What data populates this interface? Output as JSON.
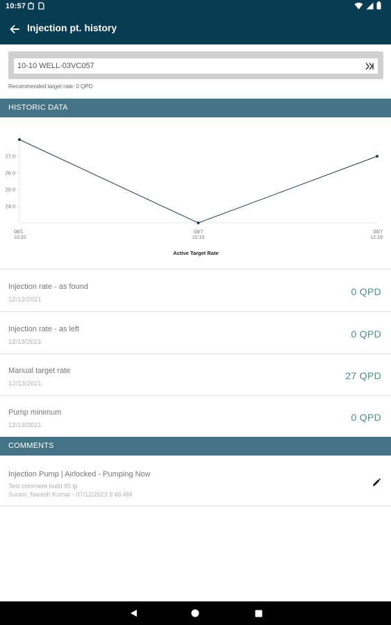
{
  "status_bar": {
    "time": "10:57"
  },
  "app_bar": {
    "title": "Injection pt. history"
  },
  "well": {
    "value": "10-10 WELL-03VC057",
    "recommended": "Recommended target rate: 0 QPD"
  },
  "historic": {
    "header": "HISTORIC DATA",
    "chart_data": {
      "type": "line",
      "title": "",
      "xlabel": "Active Target Rate",
      "ylabel": "",
      "x_ticks": [
        [
          "08/1",
          "10:20"
        ],
        [
          "08/7",
          "10:15"
        ],
        [
          "08/7",
          "12:19"
        ]
      ],
      "y_ticks": [
        "24.0",
        "25.0",
        "26.0",
        "27.0"
      ],
      "series": [
        {
          "values": [
            28.0,
            23.0,
            27.0
          ]
        }
      ],
      "ylim": [
        23.0,
        28.5
      ],
      "grid": false
    }
  },
  "metrics": [
    {
      "label": "Injection rate - as found",
      "date": "12/13/2021",
      "value": "0 QPD"
    },
    {
      "label": "Injection rate - as left",
      "date": "12/13/2021",
      "value": "0 QPD"
    },
    {
      "label": "Manual target rate",
      "date": "12/13/2021",
      "value": "27 QPD"
    },
    {
      "label": "Pump minimum",
      "date": "12/13/2021",
      "value": "0 QPD"
    }
  ],
  "comments": {
    "header": "COMMENTS",
    "items": [
      {
        "title": "Injection Pump | Airlocked - Pumping Now",
        "text": "Test comment build 95 ip",
        "author": "Suram, Naresh Kumar - 07/12/2023 9:46 AM"
      }
    ]
  },
  "colors": {
    "app_bar": "#083c52",
    "section_header": "#437385",
    "value_text": "#4e8e8c"
  }
}
